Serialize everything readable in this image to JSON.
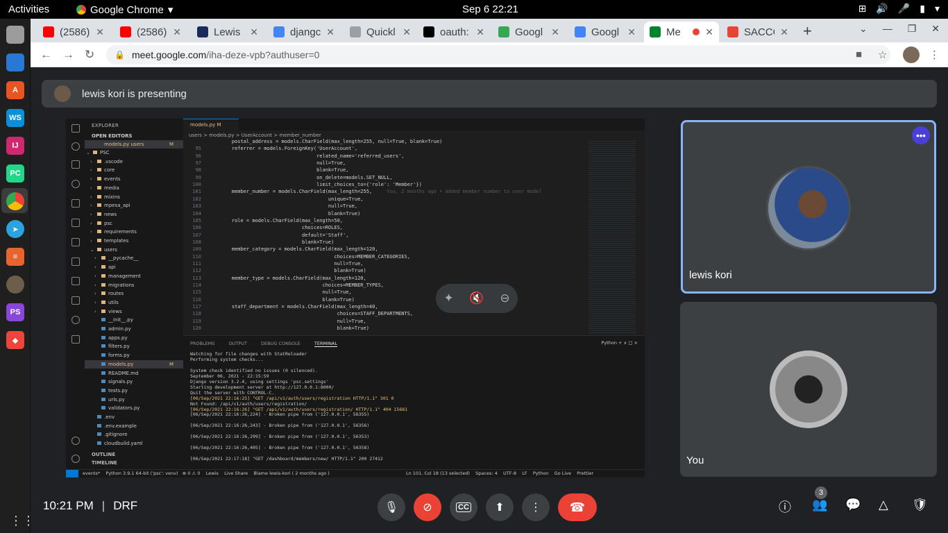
{
  "topbar": {
    "activities": "Activities",
    "app_name": "Google Chrome",
    "clock": "Sep 6  22:21"
  },
  "dock": {
    "icons": [
      "files-icon",
      "libreoffice-writer-icon",
      "software-center-icon",
      "webstorm-icon",
      "intellij-icon",
      "pycharm-icon",
      "chrome-icon",
      "telegram-icon",
      "docs-icon",
      "gimp-icon",
      "phpstorm-icon",
      "anydesk-icon"
    ]
  },
  "tabs": [
    {
      "label": "(2586)",
      "icon": "youtube-icon",
      "color": "#ff0000"
    },
    {
      "label": "(2586)",
      "icon": "youtube-icon",
      "color": "#ff0000"
    },
    {
      "label": "Lewis",
      "icon": "page-icon",
      "color": "#1a2a5a"
    },
    {
      "label": "djangc",
      "icon": "google-icon",
      "color": "#4285f4"
    },
    {
      "label": "Quickl",
      "icon": "box-icon",
      "color": "#9aa0a6"
    },
    {
      "label": "oauth:",
      "icon": "github-icon",
      "color": "#000000"
    },
    {
      "label": "Googl",
      "icon": "google-docs-icon",
      "color": "#34a853"
    },
    {
      "label": "Googl",
      "icon": "google-sheets-icon",
      "color": "#4285f4"
    },
    {
      "label": "Me",
      "icon": "meet-icon",
      "color": "#00832d"
    },
    {
      "label": "SACCC",
      "icon": "gmail-icon",
      "color": "#ea4335"
    }
  ],
  "url": {
    "host": "meet.google.com",
    "path": "/iha-deze-vpb?authuser=0"
  },
  "presenting": "lewis kori is presenting",
  "vscode": {
    "explorer_title": "EXPLORER",
    "open_editors": "OPEN EDITORS",
    "open_file": "models.py  users",
    "tree": [
      {
        "label": "PSC",
        "indent": 0,
        "arrow": "v"
      },
      {
        "label": ".vscode",
        "indent": 1,
        "arrow": ">"
      },
      {
        "label": "core",
        "indent": 1,
        "arrow": ">"
      },
      {
        "label": "events",
        "indent": 1,
        "arrow": ">"
      },
      {
        "label": "media",
        "indent": 1,
        "arrow": ">"
      },
      {
        "label": "mixins",
        "indent": 1,
        "arrow": ">"
      },
      {
        "label": "mpesa_api",
        "indent": 1,
        "arrow": ">"
      },
      {
        "label": "news",
        "indent": 1,
        "arrow": ">"
      },
      {
        "label": "psc",
        "indent": 1,
        "arrow": ">"
      },
      {
        "label": "requirements",
        "indent": 1,
        "arrow": ">"
      },
      {
        "label": "templates",
        "indent": 1,
        "arrow": ">"
      },
      {
        "label": "users",
        "indent": 1,
        "arrow": "v"
      },
      {
        "label": "__pycache__",
        "indent": 2,
        "arrow": ">"
      },
      {
        "label": "api",
        "indent": 2,
        "arrow": ">"
      },
      {
        "label": "management",
        "indent": 2,
        "arrow": ">"
      },
      {
        "label": "migrations",
        "indent": 2,
        "arrow": ">"
      },
      {
        "label": "routes",
        "indent": 2,
        "arrow": ">"
      },
      {
        "label": "utils",
        "indent": 2,
        "arrow": ">"
      },
      {
        "label": "views",
        "indent": 2,
        "arrow": ">"
      },
      {
        "label": "__init__.py",
        "indent": 2,
        "arrow": ""
      },
      {
        "label": "admin.py",
        "indent": 2,
        "arrow": ""
      },
      {
        "label": "apps.py",
        "indent": 2,
        "arrow": ""
      },
      {
        "label": "filters.py",
        "indent": 2,
        "arrow": ""
      },
      {
        "label": "forms.py",
        "indent": 2,
        "arrow": ""
      },
      {
        "label": "models.py",
        "indent": 2,
        "arrow": "",
        "selected": true
      },
      {
        "label": "README.md",
        "indent": 2,
        "arrow": ""
      },
      {
        "label": "signals.py",
        "indent": 2,
        "arrow": ""
      },
      {
        "label": "tests.py",
        "indent": 2,
        "arrow": ""
      },
      {
        "label": "urls.py",
        "indent": 2,
        "arrow": ""
      },
      {
        "label": "validators.py",
        "indent": 2,
        "arrow": ""
      },
      {
        "label": ".env",
        "indent": 1,
        "arrow": ""
      },
      {
        "label": ".env.example",
        "indent": 1,
        "arrow": ""
      },
      {
        "label": ".gitignore",
        "indent": 1,
        "arrow": ""
      },
      {
        "label": "cloudbuild.yaml",
        "indent": 1,
        "arrow": ""
      }
    ],
    "outline": "OUTLINE",
    "timeline": "TIMELINE",
    "tab": "models.py  M",
    "breadcrumbs": "users > models.py > UserAccount > member_number",
    "code": [
      {
        "n": "",
        "t": "    postal_address = models.CharField(max_length=255, null=True, blank=True)"
      },
      {
        "n": "95",
        "t": "    referrer = models.ForeignKey('UserAccount',"
      },
      {
        "n": "96",
        "t": "                                 related_name='referred_users',"
      },
      {
        "n": "97",
        "t": "                                 null=True,"
      },
      {
        "n": "98",
        "t": "                                 blank=True,"
      },
      {
        "n": "99",
        "t": "                                 on_delete=models.SET_NULL,"
      },
      {
        "n": "100",
        "t": "                                 limit_choices_to={'role': 'Member'})"
      },
      {
        "n": "101",
        "t": "    member_number = models.CharField(max_length=255,",
        "blame": "     You, 2 months ago • added member number to user model"
      },
      {
        "n": "102",
        "t": "                                     unique=True,"
      },
      {
        "n": "103",
        "t": "                                     null=True,"
      },
      {
        "n": "104",
        "t": "                                     blank=True)"
      },
      {
        "n": "105",
        "t": "    role = models.CharField(max_length=50,"
      },
      {
        "n": "106",
        "t": "                            choices=ROLES,"
      },
      {
        "n": "107",
        "t": "                            default='Staff',"
      },
      {
        "n": "108",
        "t": "                            blank=True)"
      },
      {
        "n": "109",
        "t": "    member_category = models.CharField(max_length=120,"
      },
      {
        "n": "110",
        "t": "                                       choices=MEMBER_CATEGORIES,"
      },
      {
        "n": "111",
        "t": "                                       null=True,"
      },
      {
        "n": "112",
        "t": "                                       blank=True)"
      },
      {
        "n": "113",
        "t": "    member_type = models.CharField(max_length=120,"
      },
      {
        "n": "114",
        "t": "                                   choices=MEMBER_TYPES,"
      },
      {
        "n": "115",
        "t": "                                   null=True,"
      },
      {
        "n": "116",
        "t": "                                   blank=True)"
      },
      {
        "n": "117",
        "t": "    staff_department = models.CharField(max_length=40,"
      },
      {
        "n": "118",
        "t": "                                        choices=STAFF_DEPARTMENTS,"
      },
      {
        "n": "119",
        "t": "                                        null=True,"
      },
      {
        "n": "120",
        "t": "                                        blank=True)"
      }
    ],
    "panel_tabs": [
      "PROBLEMS",
      "OUTPUT",
      "DEBUG CONSOLE",
      "TERMINAL"
    ],
    "panel_right": "Python  +  ∨  □  ×",
    "terminal": [
      {
        "t": "Watching for file changes with StatReloader"
      },
      {
        "t": "Performing system checks..."
      },
      {
        "t": ""
      },
      {
        "t": "System check identified no issues (0 silenced)."
      },
      {
        "t": "September 06, 2021 - 22:15:59"
      },
      {
        "t": "Django version 3.2.4, using settings 'psc.settings'"
      },
      {
        "t": "Starting development server at http://127.0.0.1:8000/"
      },
      {
        "t": "Quit the server with CONTROL-C."
      },
      {
        "t": "[06/Sep/2021 22:16:25] \"GET /api/v1/auth/users/registration HTTP/1.1\" 301 0",
        "hl": true
      },
      {
        "t": "Not Found: /api/v1/auth/users/registration/"
      },
      {
        "t": "[06/Sep/2021 22:16:26] \"GET /api/v1/auth/users/registration/ HTTP/1.1\" 404 15681",
        "hl": true
      },
      {
        "t": "[06/Sep/2021 22:16:26,224] - Broken pipe from ('127.0.0.1', 56355)"
      },
      {
        "t": ""
      },
      {
        "t": "[06/Sep/2021 22:16:26,243] - Broken pipe from ('127.0.0.1', 56356)"
      },
      {
        "t": ""
      },
      {
        "t": "[06/Sep/2021 22:16:26,299] - Broken pipe from ('127.0.0.1', 56353)"
      },
      {
        "t": ""
      },
      {
        "t": "[06/Sep/2021 22:16:26,405] - Broken pipe from ('127.0.0.1', 56358)"
      },
      {
        "t": ""
      },
      {
        "t": "[06/Sep/2021 22:17:18] \"GET /dashboard/members/new/ HTTP/1.1\" 200 27412"
      }
    ],
    "status_left": "events*    Python 3.9.1 64-bit ('psc': venv)   ⊗ 0 ⚠ 0    Lewis    Live Share    Blame lewis-kori ( 2 months ago )",
    "status_right": "Ln 101, Col 18 (13 selected)    Spaces: 4    UTF-8    LF    Python    Go Live    Prettier"
  },
  "participants": [
    {
      "name": "lewis kori"
    },
    {
      "name": "You"
    }
  ],
  "meeting": {
    "time": "10:21 PM",
    "separator": "|",
    "code": "DRF",
    "people_count": "3"
  }
}
